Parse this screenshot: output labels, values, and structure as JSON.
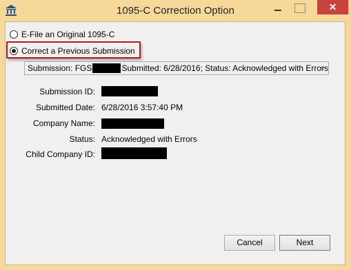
{
  "window": {
    "title": "1095-C Correction Option",
    "close_symbol": "✕"
  },
  "options": {
    "efile_label": "E-File an Original 1095-C",
    "correct_label": "Correct a Previous Submission",
    "selected": "correct"
  },
  "submission_combo": {
    "prefix": "Submission: FGS",
    "suffix": "Submitted: 6/28/2016; Status: Acknowledged with Errors"
  },
  "fields": {
    "submission_id_label": "Submission ID:",
    "submitted_date_label": "Submitted Date:",
    "submitted_date_value": "6/28/2016 3:57:40 PM",
    "company_name_label": "Company Name:",
    "status_label": "Status:",
    "status_value": "Acknowledged with Errors",
    "child_company_id_label": "Child Company ID:"
  },
  "buttons": {
    "cancel_label": "Cancel",
    "next_label": "Next"
  },
  "icons": {
    "app": "bank-building-icon",
    "minimize": "minimize-icon",
    "maximize": "maximize-icon",
    "close": "close-icon",
    "dropdown": "chevron-down-icon"
  },
  "colors": {
    "frame": "#f6d89a",
    "close": "#c7433b",
    "highlight": "#b01c1c"
  }
}
